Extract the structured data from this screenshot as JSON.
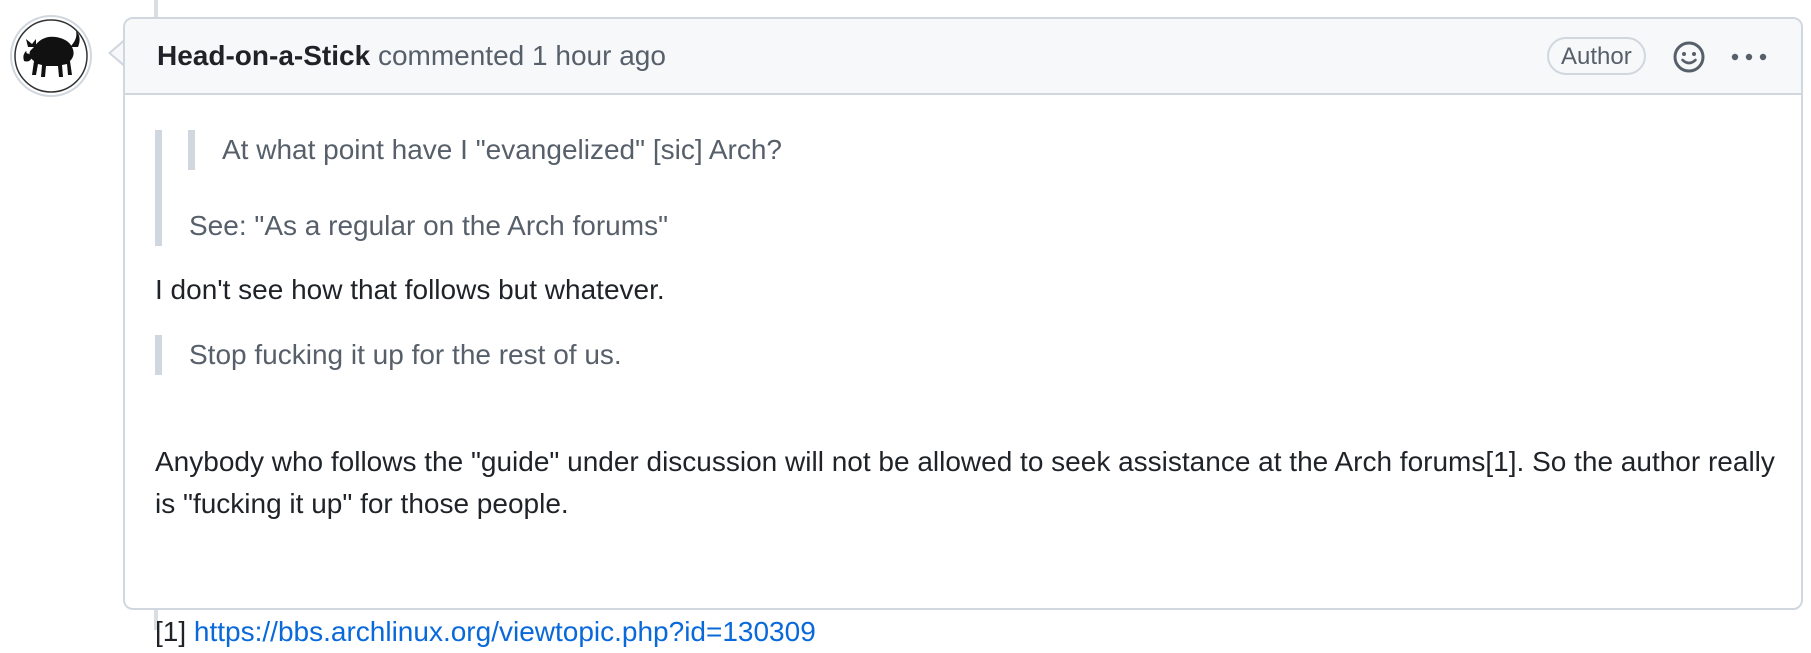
{
  "comment": {
    "author": "Head-on-a-Stick",
    "action": "commented",
    "timestamp": "1 hour ago",
    "badge": "Author",
    "icons": {
      "avatar": "black-cat-avatar-icon",
      "reaction": "smiley-icon",
      "more": "kebab-horizontal-icon"
    },
    "quote_nested": "At what point have I \"evangelized\" [sic] Arch?",
    "quote_outer": "See: \"As a regular on the Arch forums\"",
    "paragraph_1": "I don't see how that follows but whatever.",
    "quote_2": "Stop fucking it up for the rest of us.",
    "paragraph_2": "Anybody who follows the \"guide\" under discussion will not be allowed to seek assistance at the Arch forums[1]. So the author really is \"fucking it up\" for those people.",
    "footnote_label": "[1]",
    "footnote_link": "https://bbs.archlinux.org/viewtopic.php?id=130309"
  },
  "colors": {
    "link": "#0969da",
    "border": "#d0d7de",
    "header_bg": "#f6f8fa",
    "muted_text": "#57606a",
    "text": "#1f2328"
  }
}
